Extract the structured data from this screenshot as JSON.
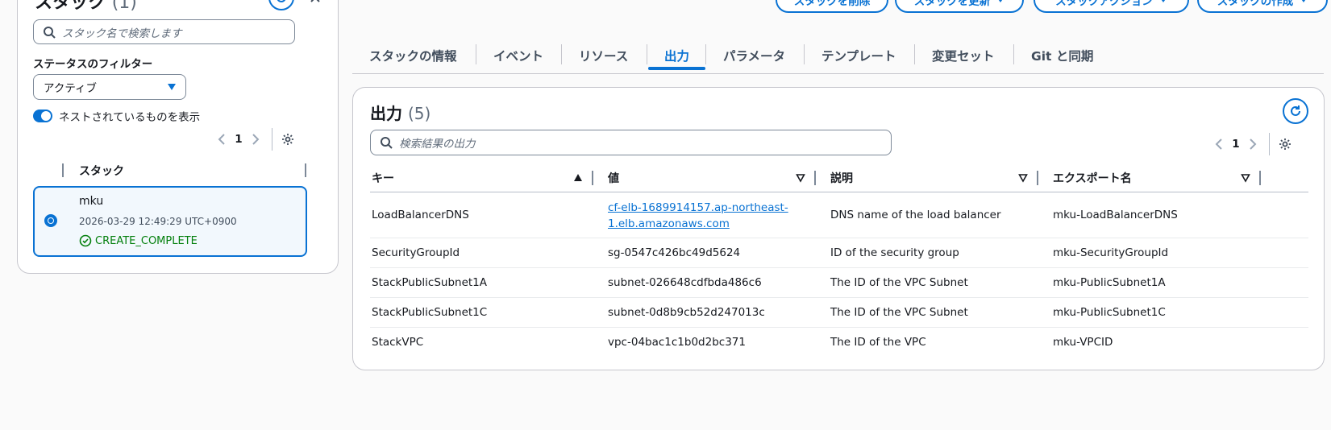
{
  "left_panel": {
    "title": "スタック",
    "count": "(1)",
    "search_placeholder": "スタック名で検索します",
    "filter_label": "ステータスのフィルター",
    "filter_value": "アクティブ",
    "toggle_label": "ネストされているものを表示",
    "page": "1",
    "column_header": "スタック",
    "stack": {
      "name": "mku",
      "timestamp": "2026-03-29 12:49:29 UTC+0900",
      "status": "CREATE_COMPLETE"
    }
  },
  "top_buttons": [
    {
      "label": "スタックを削除"
    },
    {
      "label": "スタックを更新"
    },
    {
      "label": "スタックアクション"
    },
    {
      "label": "スタックの作成"
    }
  ],
  "tabs": [
    {
      "label": "スタックの情報"
    },
    {
      "label": "イベント"
    },
    {
      "label": "リソース"
    },
    {
      "label": "出力",
      "active": true
    },
    {
      "label": "パラメータ"
    },
    {
      "label": "テンプレート"
    },
    {
      "label": "変更セット"
    },
    {
      "label": "Git と同期"
    }
  ],
  "outputs": {
    "title": "出力",
    "count": "(5)",
    "search_placeholder": "検索結果の出力",
    "page": "1",
    "columns": [
      "キー",
      "値",
      "説明",
      "エクスポート名"
    ],
    "rows": [
      {
        "key": "LoadBalancerDNS",
        "value_line1": "cf-elb-1689914157.ap-northeast-",
        "value_line2": "1.elb.amazonaws.com",
        "description": "DNS name of the load balancer",
        "export": "mku-LoadBalancerDNS"
      },
      {
        "key": "SecurityGroupId",
        "value": "sg-0547c426bc49d5624",
        "description": "ID of the security group",
        "export": "mku-SecurityGroupId"
      },
      {
        "key": "StackPublicSubnet1A",
        "value": "subnet-026648cdfbda486c6",
        "description": "The ID of the VPC Subnet",
        "export": "mku-PublicSubnet1A"
      },
      {
        "key": "StackPublicSubnet1C",
        "value": "subnet-0d8b9cb52d247013c",
        "description": "The ID of the VPC Subnet",
        "export": "mku-PublicSubnet1C"
      },
      {
        "key": "StackVPC",
        "value": "vpc-04bac1c1b0d2bc371",
        "description": "The ID of the VPC",
        "export": "mku-VPCID"
      }
    ]
  },
  "colors": {
    "accent": "#0972d3",
    "success": "#037f0c",
    "selected_bg": "#f2f8fd"
  }
}
